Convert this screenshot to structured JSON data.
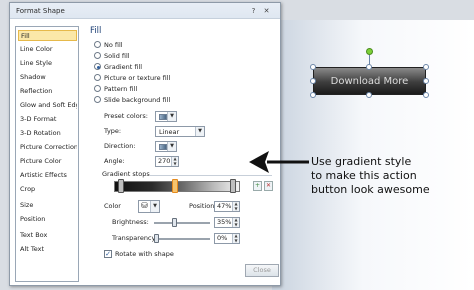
{
  "dialog": {
    "title": "Format Shape",
    "help_icon": "?",
    "close_icon": "✕",
    "close_button_label": "Close"
  },
  "sidebar": {
    "items": [
      {
        "label": "Fill",
        "selected": true
      },
      {
        "label": "Line Color"
      },
      {
        "label": "Line Style"
      },
      {
        "label": "Shadow"
      },
      {
        "label": "Reflection"
      },
      {
        "label": "Glow and Soft Edges"
      },
      {
        "label": "3-D Format"
      },
      {
        "label": "3-D Rotation"
      },
      {
        "label": "Picture Corrections"
      },
      {
        "label": "Picture Color"
      },
      {
        "label": "Artistic Effects"
      },
      {
        "label": "Crop"
      },
      {
        "label": "Size"
      },
      {
        "label": "Position"
      },
      {
        "label": "Text Box"
      },
      {
        "label": "Alt Text"
      }
    ]
  },
  "fill": {
    "title": "Fill",
    "options": [
      {
        "label": "No fill",
        "checked": false
      },
      {
        "label": "Solid fill",
        "checked": false
      },
      {
        "label": "Gradient fill",
        "checked": true
      },
      {
        "label": "Picture or texture fill",
        "checked": false
      },
      {
        "label": "Pattern fill",
        "checked": false
      },
      {
        "label": "Slide background fill",
        "checked": false
      }
    ],
    "preset_colors_label": "Preset colors:",
    "type_label": "Type:",
    "type_value": "Linear",
    "direction_label": "Direction:",
    "angle_label": "Angle:",
    "angle_value": "270°",
    "gradient_stops_label": "Gradient stops",
    "color_label": "Color",
    "position_label": "Position:",
    "position_value": "47%",
    "brightness_label": "Brightness:",
    "brightness_value": "35%",
    "brightness_level": 0.35,
    "transparency_label": "Transparency:",
    "transparency_value": "0%",
    "transparency_level": 0,
    "rotate_label": "Rotate with shape",
    "rotate_checked": true
  },
  "slide": {
    "button_label": "Download More"
  },
  "annotation": {
    "lines": [
      "Use gradient style",
      "to make this action",
      "button look awesome"
    ]
  },
  "colors": {
    "selected_item_bg": "#fbe8a8",
    "active_stop": "#f6c46e",
    "rotation_handle": "#7cd137"
  }
}
